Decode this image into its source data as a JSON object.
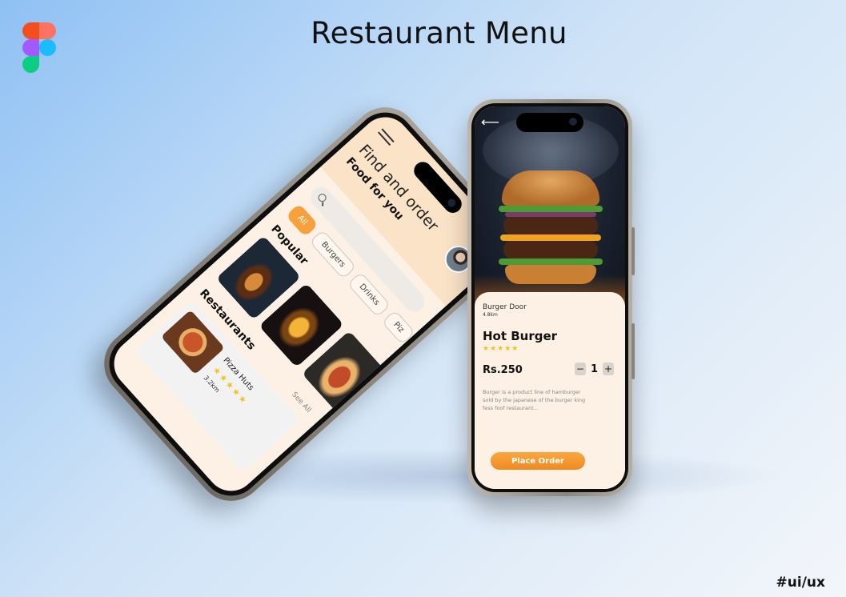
{
  "page": {
    "title": "Restaurant Menu",
    "hashtag": "#ui/ux",
    "logo_icon": "figma-logo-icon"
  },
  "left_phone": {
    "headline": "Find and order",
    "subheadline": "Food for you",
    "search_placeholder": "",
    "categories": [
      {
        "label": "All",
        "active": true
      },
      {
        "label": "Burgers",
        "active": false
      },
      {
        "label": "Drinks",
        "active": false
      },
      {
        "label": "Piz",
        "active": false
      }
    ],
    "popular_title": "Popular",
    "restaurants_title": "Restaurants",
    "see_all": "See All",
    "restaurant": {
      "name": "Pizza Huts",
      "stars": "★★★★★",
      "distance": "3.2km"
    }
  },
  "right_phone": {
    "back_icon": "back-arrow-icon",
    "store_name": "Burger Door",
    "store_distance": "4.8km",
    "item_name": "Hot Burger",
    "stars": "★★★★★",
    "price": "Rs.250",
    "quantity": "1",
    "minus": "−",
    "plus": "+",
    "description": "Burger is a product line of hamburger sold by the japanese of the burger king fess foof restaurant...",
    "cta": "Place Order"
  },
  "colors": {
    "accent_orange": "#f7a03c",
    "cream": "#fdf1e5",
    "star_yellow": "#f4c21a"
  }
}
